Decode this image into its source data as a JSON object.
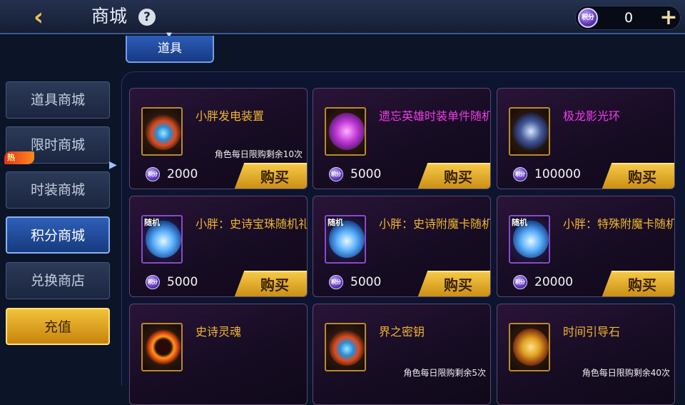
{
  "header": {
    "back_icon": "back-arrow-icon",
    "title": "商城",
    "help_label": "?",
    "currency_icon": "points-coin-icon",
    "currency_icon_text": "积分",
    "currency_value": "0",
    "add_label": "+"
  },
  "tab": {
    "label": "道具"
  },
  "sidebar": {
    "items": [
      {
        "label": "道具商城",
        "active": false
      },
      {
        "label": "限时商城",
        "active": false,
        "badge": "热"
      },
      {
        "label": "时装商城",
        "active": false
      },
      {
        "label": "积分商城",
        "active": true
      },
      {
        "label": "兑换商店",
        "active": false
      },
      {
        "label": "充值",
        "active": false
      }
    ]
  },
  "shop": {
    "buy_label": "购买",
    "price_icon": "points-coin-icon",
    "price_icon_text": "积分",
    "items": [
      {
        "name": "小胖发电装置",
        "name_color": "#f0b62e",
        "limit": "角色每日限购剩余10次",
        "price": "2000",
        "icon": "electric-device-icon"
      },
      {
        "name": "遗忘英雄时装单件随机",
        "name_color": "#f23be8",
        "limit": "",
        "price": "5000",
        "icon": "costume-chest-icon"
      },
      {
        "name": "极龙影光环",
        "name_color": "#f23be8",
        "limit": "",
        "price": "100000",
        "icon": "dragon-aura-icon"
      },
      {
        "name": "小胖：史诗宝珠随机礼盒",
        "name_color": "#f0b62e",
        "limit": "",
        "price": "5000",
        "icon": "random-box-icon",
        "tag": "随机"
      },
      {
        "name": "小胖：史诗附魔卡随机礼盒",
        "name_color": "#f0b62e",
        "limit": "",
        "price": "5000",
        "icon": "random-box-icon",
        "tag": "随机"
      },
      {
        "name": "小胖：特殊附魔卡随机礼盒",
        "name_color": "#f0b62e",
        "limit": "",
        "price": "20000",
        "icon": "random-box-icon",
        "tag": "随机"
      },
      {
        "name": "史诗灵魂",
        "name_color": "#f0b62e",
        "limit": "",
        "price": "",
        "icon": "epic-soul-icon"
      },
      {
        "name": "界之密钥",
        "name_color": "#f0b62e",
        "limit": "角色每日限购剩余5次",
        "price": "",
        "icon": "realm-key-icon"
      },
      {
        "name": "时间引导石",
        "name_color": "#f0b62e",
        "limit": "角色每日限购剩余40次",
        "price": "",
        "icon": "time-guide-stone-icon"
      }
    ]
  },
  "colors": {
    "accent_gold": "#f0b62e",
    "accent_blue": "#2f5fb8",
    "epic_purple": "#f23be8",
    "background": "#0c1428"
  }
}
